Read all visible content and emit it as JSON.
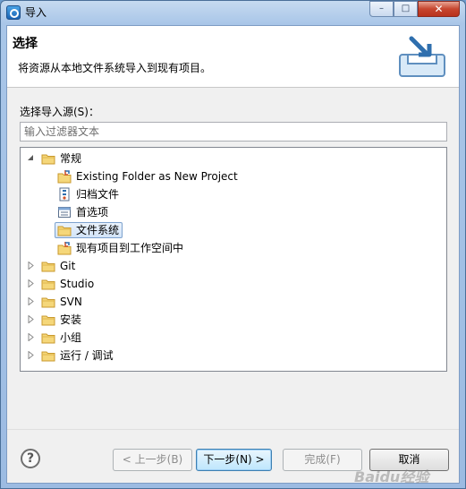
{
  "window": {
    "title": "导入",
    "close_glyph": "✕",
    "max_glyph": "□",
    "min_glyph": "–"
  },
  "banner": {
    "title": "选择",
    "description": "将资源从本地文件系统导入到现有项目。",
    "icon": "import-tray-icon"
  },
  "source_label": "选择导入源(S)：",
  "filter": {
    "placeholder": "输入过滤器文本",
    "value": ""
  },
  "tree": {
    "items": [
      {
        "label": "常规",
        "expanded": true,
        "icon": "folder-icon"
      },
      {
        "label": "Existing Folder as New Project",
        "icon": "folder-import-icon"
      },
      {
        "label": "归档文件",
        "icon": "archive-icon"
      },
      {
        "label": "首选项",
        "icon": "preferences-icon"
      },
      {
        "label": "文件系统",
        "icon": "folder-icon",
        "selected": true
      },
      {
        "label": "现有项目到工作空间中",
        "icon": "folder-import-icon"
      },
      {
        "label": "Git",
        "expanded": false,
        "icon": "folder-icon"
      },
      {
        "label": "Studio",
        "expanded": false,
        "icon": "folder-icon"
      },
      {
        "label": "SVN",
        "expanded": false,
        "icon": "folder-icon"
      },
      {
        "label": "安装",
        "expanded": false,
        "icon": "folder-icon"
      },
      {
        "label": "小组",
        "expanded": false,
        "icon": "folder-icon"
      },
      {
        "label": "运行 / 调试",
        "expanded": false,
        "icon": "folder-icon"
      }
    ]
  },
  "buttons": {
    "help": "?",
    "back": "< 上一步(B)",
    "next": "下一步(N) >",
    "finish": "完成(F)",
    "cancel": "取消"
  },
  "watermark": "Baidu经验"
}
